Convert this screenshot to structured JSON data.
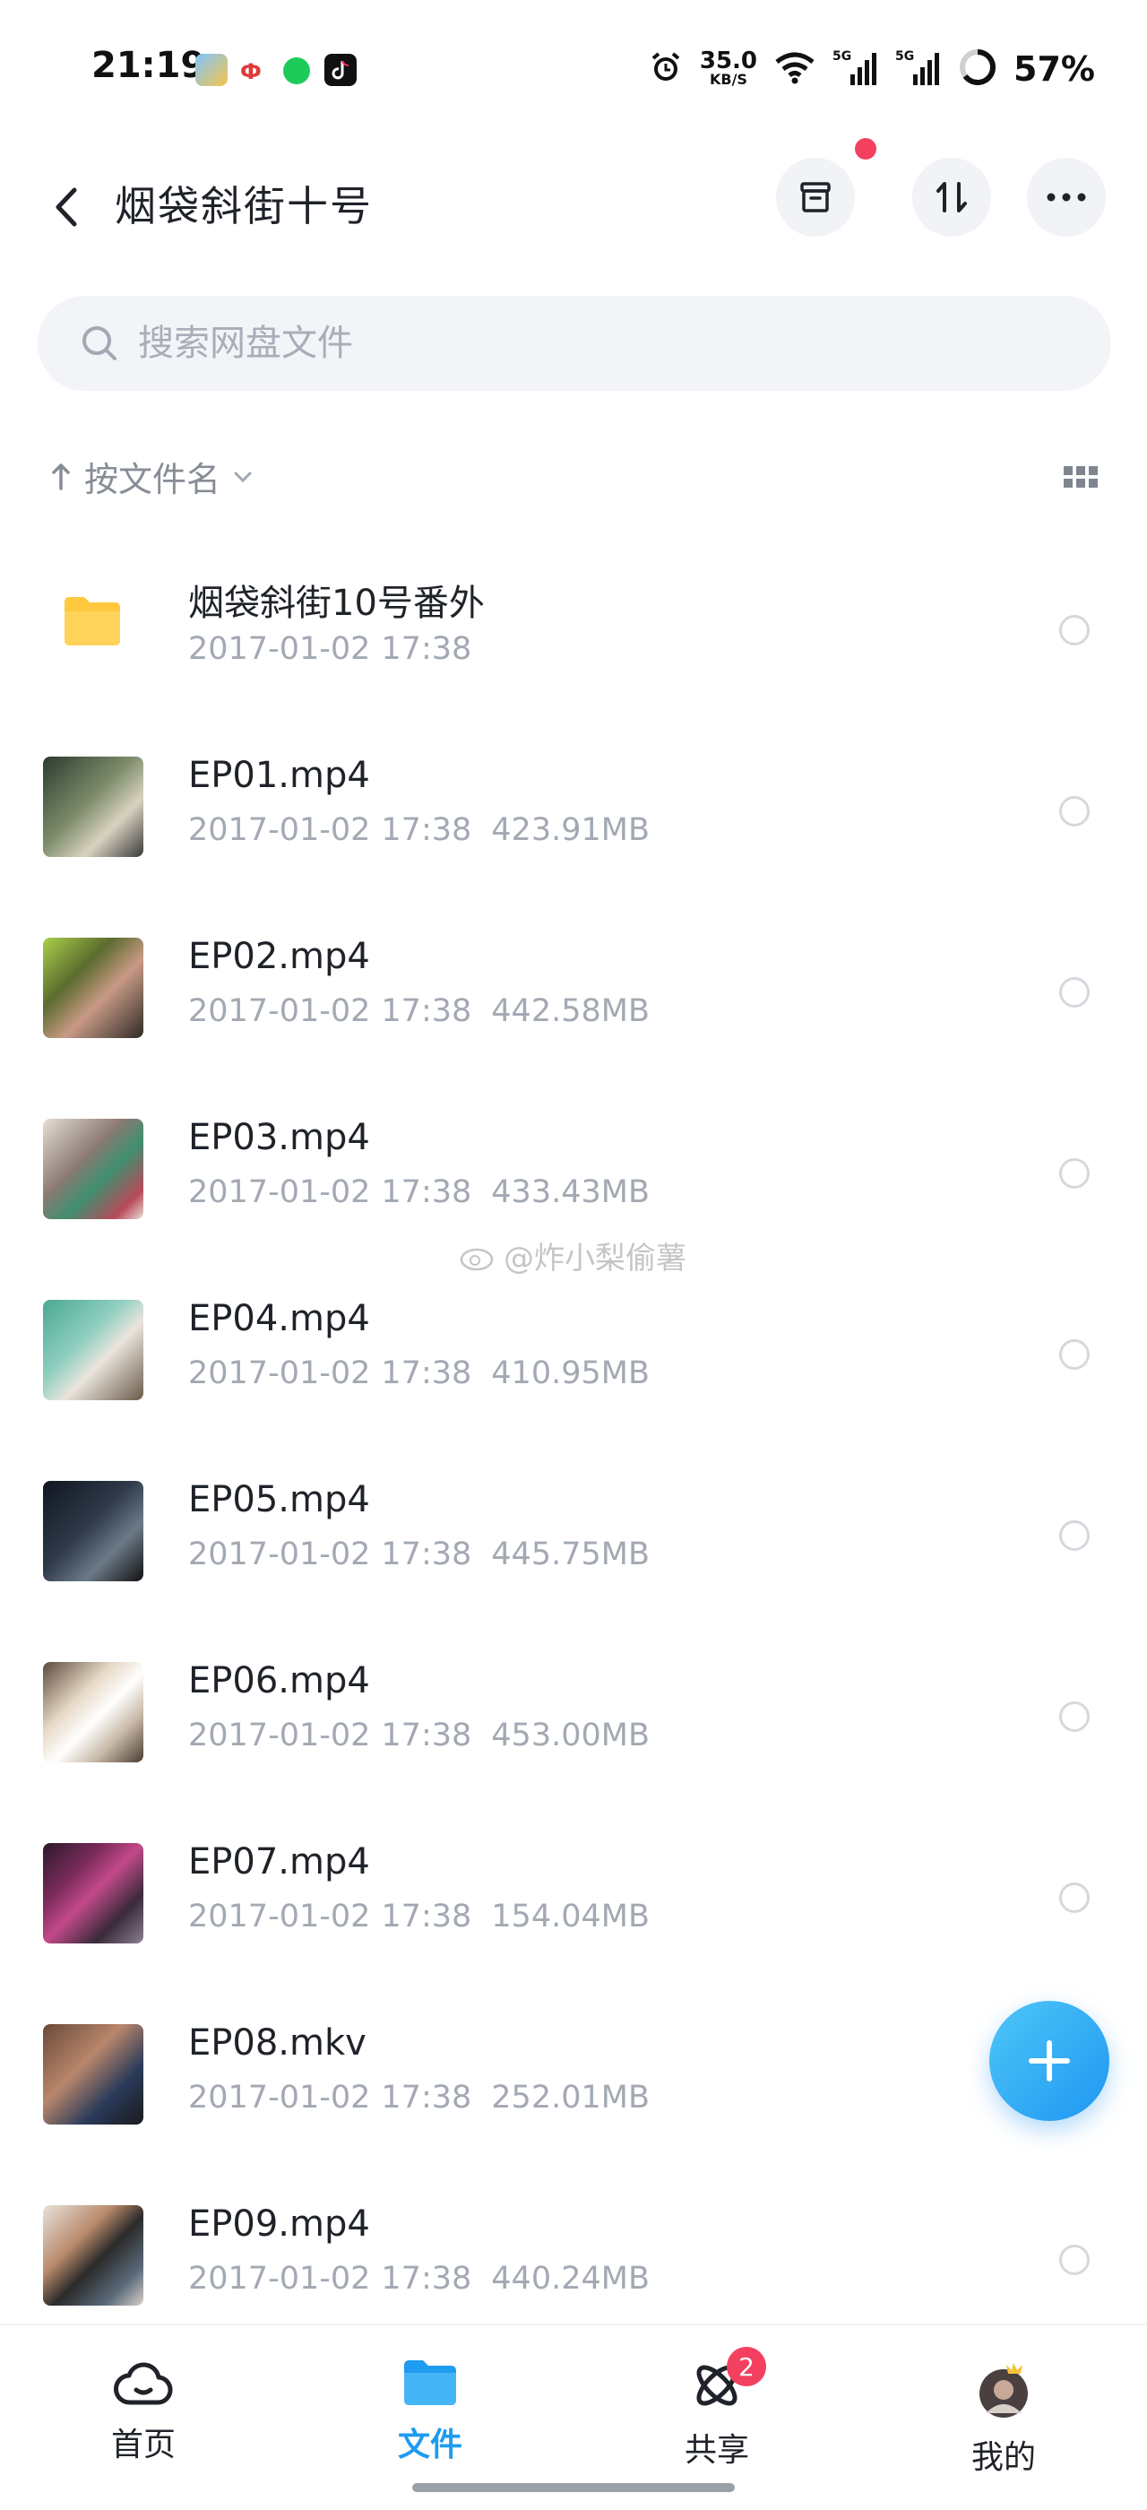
{
  "status_bar": {
    "time": "21:19",
    "net_speed_value": "35.0",
    "net_speed_unit": "KB/S",
    "signal1_label": "5G",
    "signal2_label": "5G",
    "battery": "57%"
  },
  "header": {
    "title": "烟袋斜街十号"
  },
  "search": {
    "placeholder": "搜索网盘文件"
  },
  "sort": {
    "label": "按文件名"
  },
  "files": [
    {
      "name": "烟袋斜街10号番外",
      "date": "2017-01-02",
      "time": "17:38",
      "size": "",
      "type": "folder"
    },
    {
      "name": "EP01.mp4",
      "date": "2017-01-02",
      "time": "17:38",
      "size": "423.91MB",
      "type": "video"
    },
    {
      "name": "EP02.mp4",
      "date": "2017-01-02",
      "time": "17:38",
      "size": "442.58MB",
      "type": "video"
    },
    {
      "name": "EP03.mp4",
      "date": "2017-01-02",
      "time": "17:38",
      "size": "433.43MB",
      "type": "video"
    },
    {
      "name": "EP04.mp4",
      "date": "2017-01-02",
      "time": "17:38",
      "size": "410.95MB",
      "type": "video"
    },
    {
      "name": "EP05.mp4",
      "date": "2017-01-02",
      "time": "17:38",
      "size": "445.75MB",
      "type": "video"
    },
    {
      "name": "EP06.mp4",
      "date": "2017-01-02",
      "time": "17:38",
      "size": "453.00MB",
      "type": "video"
    },
    {
      "name": "EP07.mp4",
      "date": "2017-01-02",
      "time": "17:38",
      "size": "154.04MB",
      "type": "video"
    },
    {
      "name": "EP08.mkv",
      "date": "2017-01-02",
      "time": "17:38",
      "size": "252.01MB",
      "type": "video"
    },
    {
      "name": "EP09.mp4",
      "date": "2017-01-02",
      "time": "17:38",
      "size": "440.24MB",
      "type": "video"
    }
  ],
  "watermark": "@炸小梨偷薯",
  "nav": {
    "home": "首页",
    "files": "文件",
    "share": "共享",
    "share_badge": "2",
    "me": "我的"
  },
  "colors": {
    "accent": "#1f9bf0",
    "badge": "#f4405f",
    "folder": "#ffc83d"
  }
}
